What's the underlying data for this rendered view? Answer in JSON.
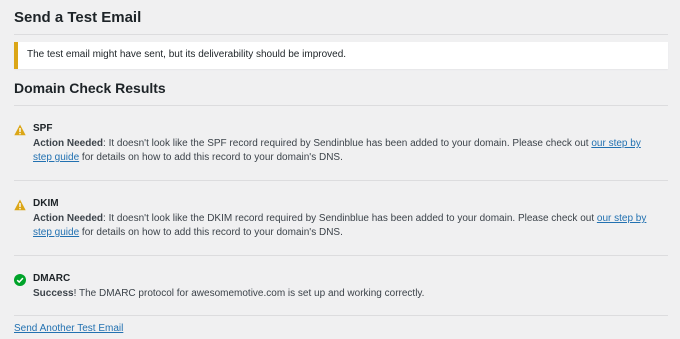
{
  "page": {
    "title": "Send a Test Email",
    "notice": "The test email might have sent, but its deliverability should be improved.",
    "section_title": "Domain Check Results",
    "footer_link": "Send Another Test Email"
  },
  "checks": [
    {
      "name": "SPF",
      "status": "warning",
      "icon": "warning-icon",
      "prefix": "Action Needed",
      "text": ": It doesn't look like the SPF record required by Sendinblue has been added to your domain. Please check out ",
      "link": "our step by step guide",
      "suffix": " for details on how to add this record to your domain's DNS."
    },
    {
      "name": "DKIM",
      "status": "warning",
      "icon": "warning-icon",
      "prefix": "Action Needed",
      "text": ": It doesn't look like the DKIM record required by Sendinblue has been added to your domain. Please check out ",
      "link": "our step by step guide",
      "suffix": " for details on how to add this record to your domain's DNS."
    },
    {
      "name": "DMARC",
      "status": "success",
      "icon": "check-circle-icon",
      "prefix": "Success",
      "text": "! The DMARC protocol for awesomemotive.com is set up and working correctly."
    }
  ],
  "colors": {
    "warning": "#dba617",
    "success": "#00a32a",
    "link": "#2271b1"
  }
}
